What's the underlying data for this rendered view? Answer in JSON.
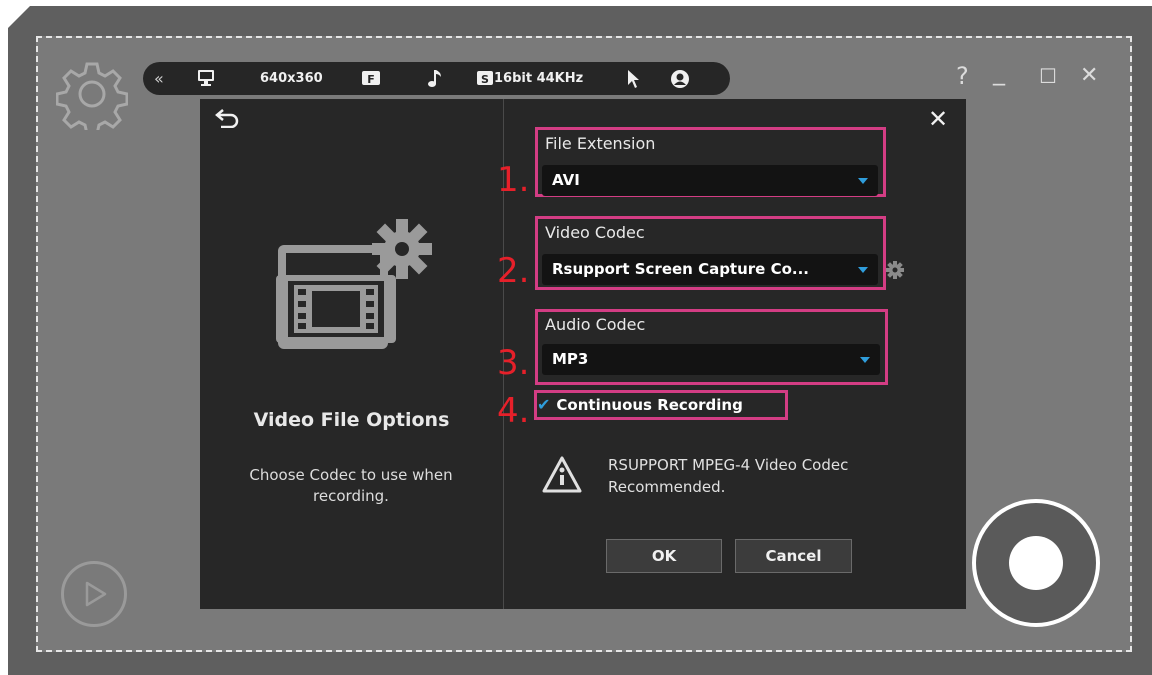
{
  "toolbar": {
    "collapse_glyph": "«",
    "resolution": "640x360",
    "framerate_badge": "F",
    "audio_badge": "S",
    "audio_format": "16bit 44KHz"
  },
  "window_controls": {
    "help": "?",
    "minimize": "_",
    "maximize": "☐",
    "close": "✕"
  },
  "dialog": {
    "close": "✕",
    "title": "Video File Options",
    "description": "Choose Codec to use when recording.",
    "file_extension": {
      "label": "File Extension",
      "value": "AVI",
      "number": "1."
    },
    "video_codec": {
      "label": "Video Codec",
      "value": "Rsupport Screen Capture Co...",
      "number": "2."
    },
    "audio_codec": {
      "label": "Audio Codec",
      "value": "MP3",
      "number": "3."
    },
    "continuous": {
      "label": "Continuous Recording",
      "checked": true,
      "number": "4."
    },
    "warning": "RSUPPORT MPEG-4 Video Codec Recommended.",
    "ok": "OK",
    "cancel": "Cancel"
  },
  "colors": {
    "highlight": "#d33d84",
    "number": "#e6202a",
    "accent": "#2f9ddb"
  },
  "icons": [
    "settings-gear-icon",
    "monitor-icon",
    "music-note-icon",
    "cursor-icon",
    "webcam-icon",
    "back-arrow-icon",
    "video-settings-icon",
    "warning-icon",
    "codec-settings-icon",
    "record-icon",
    "play-icon"
  ]
}
